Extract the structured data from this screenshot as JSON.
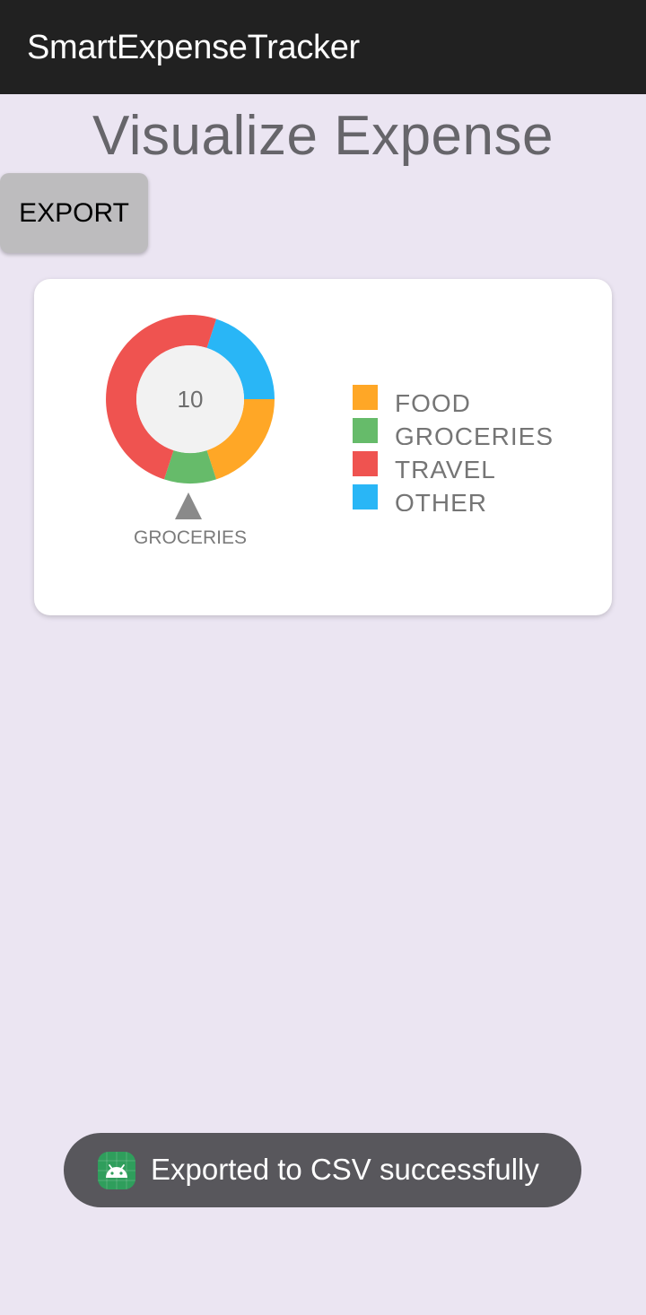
{
  "appbar": {
    "title": "SmartExpenseTracker"
  },
  "page": {
    "heading": "Visualize Expense"
  },
  "toolbar": {
    "export_label": "EXPORT"
  },
  "chart": {
    "center_value": "10",
    "selected_label": "GROCERIES",
    "legend": [
      {
        "label": "FOOD",
        "color": "#FFA726"
      },
      {
        "label": "GROCERIES",
        "color": "#66BB6A"
      },
      {
        "label": "TRAVEL",
        "color": "#EF5350"
      },
      {
        "label": "OTHER",
        "color": "#29B6F6"
      }
    ]
  },
  "chart_data": {
    "type": "pie",
    "categories": [
      "OTHER",
      "FOOD",
      "GROCERIES",
      "TRAVEL"
    ],
    "values": [
      20,
      20,
      10,
      50
    ],
    "colors": [
      "#29B6F6",
      "#FFA726",
      "#66BB6A",
      "#EF5350"
    ]
  },
  "toast": {
    "message": "Exported to CSV successfully",
    "icon": "android-icon"
  }
}
